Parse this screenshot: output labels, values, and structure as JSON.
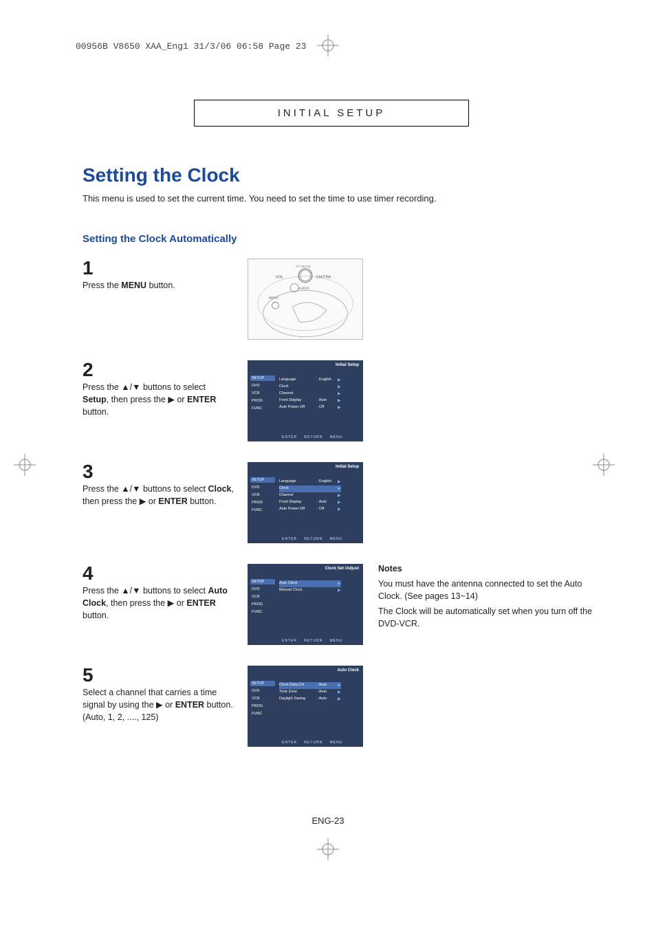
{
  "print_header": "00956B V8650 XAA_Eng1  31/3/06  06:58  Page 23",
  "section_header": "INITIAL SETUP",
  "title": "Setting the Clock",
  "description": "This menu is used to set the current time. You need to set the time to use timer recording.",
  "subsection_title": "Setting the Clock Automatically",
  "steps": {
    "s1": {
      "num": "1",
      "text_parts": {
        "a": "Press the ",
        "b": "MENU",
        "c": " button."
      }
    },
    "s2": {
      "num": "2",
      "text_parts": {
        "a": "Press the ▲/▼ buttons to select ",
        "b": "Setup",
        "c": ", then press the ▶ or ",
        "d": "ENTER",
        "e": " button."
      }
    },
    "s3": {
      "num": "3",
      "text_parts": {
        "a": "Press the ▲/▼ buttons to select ",
        "b": "Clock",
        "c": ", then press the ▶ or ",
        "d": "ENTER",
        "e": " button."
      }
    },
    "s4": {
      "num": "4",
      "text_parts": {
        "a": "Press the ▲/▼ buttons to select ",
        "b": "Auto Clock",
        "c": ", then press the ▶ or ",
        "d": "ENTER",
        "e": " button."
      }
    },
    "s5": {
      "num": "5",
      "text_parts": {
        "a": "Select a channel that carries a time signal by using the ▶ or ",
        "b": "ENTER",
        "c": " button.",
        "d": "(Auto, 1, 2, ...., 125)"
      }
    }
  },
  "shot_remote": {
    "labels": {
      "vol": "VOL",
      "ch": "CH/TRK",
      "audio": "AUDIO",
      "menu": "MENU",
      "tvmute": "TV MUTE"
    }
  },
  "shot2": {
    "header": "Initial Setup",
    "sidebar": [
      "SETUP",
      "DVD",
      "VCR",
      "PROG",
      "FUNC"
    ],
    "menu": [
      {
        "k": "Language",
        "v": ": English"
      },
      {
        "k": "Clock",
        "v": ""
      },
      {
        "k": "Channel",
        "v": ""
      },
      {
        "k": "Front Display",
        "v": ": Auto"
      },
      {
        "k": "Auto Power Off",
        "v": ": Off"
      }
    ]
  },
  "shot3": {
    "header": "Initial Setup",
    "sidebar": [
      "SETUP",
      "DVD",
      "VCR",
      "PROG",
      "FUNC"
    ],
    "menu": [
      {
        "k": "Language",
        "v": ": English"
      },
      {
        "k": "Clock",
        "v": ""
      },
      {
        "k": "Channel",
        "v": ""
      },
      {
        "k": "Front Display",
        "v": ": Auto"
      },
      {
        "k": "Auto Power Off",
        "v": ": Off"
      }
    ]
  },
  "shot4": {
    "header": "Clock Set /Adjust",
    "sidebar": [
      "SETUP",
      "DVD",
      "VCR",
      "PROG",
      "FUNC"
    ],
    "menu": [
      {
        "k": "Auto Clock",
        "v": ""
      },
      {
        "k": "Manual Clock",
        "v": ""
      }
    ]
  },
  "shot5": {
    "header": "Auto Clock",
    "sidebar": [
      "SETUP",
      "DVD",
      "VCR",
      "PROG",
      "FUNC"
    ],
    "menu": [
      {
        "k": "Clock Data CH",
        "v": ": Auto"
      },
      {
        "k": "Time Zone",
        "v": ": Auto"
      },
      {
        "k": "Daylight Saving",
        "v": ": Auto"
      }
    ]
  },
  "shot_footer": {
    "enter": "ENTER",
    "return": "RETURN",
    "menu": "MENU"
  },
  "notes": {
    "heading": "Notes",
    "p1": "You must have the antenna connected to set the Auto Clock. (See pages 13~14)",
    "p2": "The Clock will be automatically set when you turn off the DVD-VCR."
  },
  "page_number": "ENG-23"
}
